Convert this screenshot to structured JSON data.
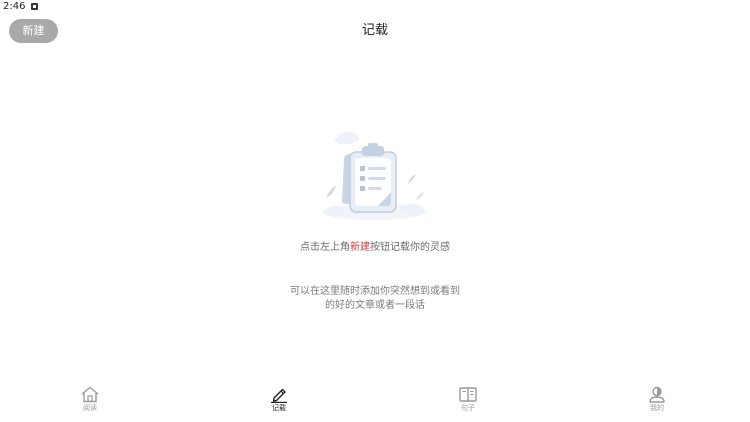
{
  "status_bar": {
    "time": "2:46"
  },
  "header": {
    "new_button_label": "新建",
    "title": "记载"
  },
  "empty_state": {
    "hint_prefix": "点击左上角",
    "hint_highlight": "新建",
    "hint_suffix": "按钮记载你的灵感",
    "description_line1": "可以在这里随时添加你突然想到或看到",
    "description_line2": "的好的文章或者一段话"
  },
  "tabs": [
    {
      "label": "阅读",
      "icon": "home-icon",
      "active": false
    },
    {
      "label": "记载",
      "icon": "pen-icon",
      "active": true
    },
    {
      "label": "句子",
      "icon": "book-icon",
      "active": false
    },
    {
      "label": "我的",
      "icon": "person-icon",
      "active": false
    }
  ],
  "colors": {
    "accent": "#d23b3b",
    "new_button_bg": "#a9a9a9",
    "tab_inactive": "#9a9a9a",
    "tab_active": "#222222"
  }
}
